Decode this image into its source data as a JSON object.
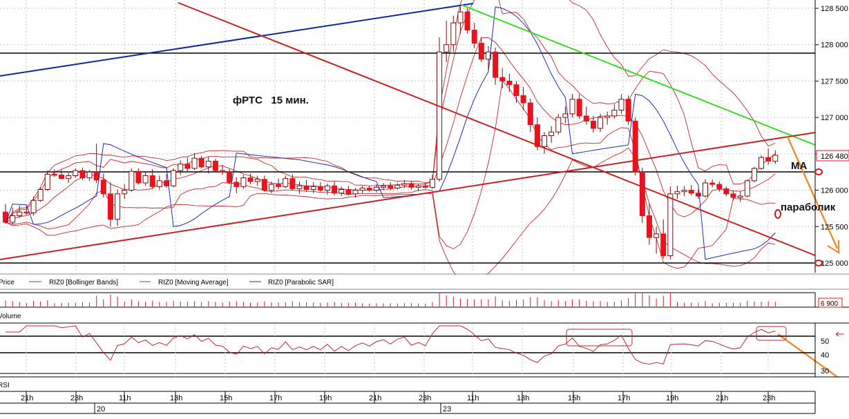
{
  "chart_data": {
    "type": "candlestick",
    "title": "фРТС   15 мин.",
    "price_axis": {
      "ticks": [
        125000,
        125500,
        126000,
        126500,
        127000,
        127500,
        128000,
        128500
      ],
      "min": 124900,
      "max": 128560,
      "last_price_label": "126 480"
    },
    "legend": [
      "Price",
      "RIZ0 [Bollinger Bands]",
      "RIZ0 [Moving Average]",
      "RIZ0 [Parabolic SAR]"
    ],
    "annotations": {
      "ma": "MA",
      "parabolic": "параболик"
    },
    "candles_ohlc": [
      [
        125700,
        125810,
        125540,
        125560
      ],
      [
        125560,
        125760,
        125530,
        125650
      ],
      [
        125650,
        125790,
        125620,
        125700
      ],
      [
        125700,
        125780,
        125660,
        125690
      ],
      [
        125690,
        125910,
        125650,
        125860
      ],
      [
        125860,
        126040,
        125840,
        126010
      ],
      [
        126010,
        126270,
        125990,
        126220
      ],
      [
        126220,
        126290,
        126180,
        126210
      ],
      [
        126210,
        126280,
        126150,
        126160
      ],
      [
        126160,
        126240,
        126100,
        126200
      ],
      [
        126200,
        126300,
        126170,
        126270
      ],
      [
        126270,
        126310,
        126140,
        126170
      ],
      [
        126170,
        126280,
        126130,
        126250
      ],
      [
        126250,
        126640,
        126100,
        126140
      ],
      [
        126140,
        126230,
        125900,
        125950
      ],
      [
        125950,
        126110,
        125500,
        125600
      ],
      [
        125600,
        126010,
        125510,
        125950
      ],
      [
        125950,
        126080,
        125880,
        126000
      ],
      [
        126000,
        126300,
        125980,
        126260
      ],
      [
        126260,
        126300,
        126080,
        126100
      ],
      [
        126100,
        126250,
        126060,
        126200
      ],
      [
        126200,
        126290,
        126020,
        126050
      ],
      [
        126050,
        126200,
        126010,
        126130
      ],
      [
        126130,
        126220,
        126030,
        126060
      ],
      [
        126060,
        126300,
        126040,
        126270
      ],
      [
        126270,
        126410,
        126210,
        126360
      ],
      [
        126360,
        126450,
        126250,
        126300
      ],
      [
        126300,
        126510,
        126280,
        126440
      ],
      [
        126440,
        126470,
        126300,
        126320
      ],
      [
        126320,
        126460,
        126230,
        126400
      ],
      [
        126400,
        126430,
        126240,
        126270
      ],
      [
        126270,
        126350,
        126210,
        126250
      ],
      [
        126250,
        126290,
        126080,
        126110
      ],
      [
        126110,
        126180,
        125960,
        126050
      ],
      [
        126050,
        126210,
        126020,
        126170
      ],
      [
        126170,
        126230,
        126080,
        126120
      ],
      [
        126120,
        126200,
        126060,
        126150
      ],
      [
        126150,
        126200,
        125980,
        126000
      ],
      [
        126000,
        126120,
        125960,
        126080
      ],
      [
        126080,
        126160,
        126010,
        126050
      ],
      [
        126050,
        126200,
        126030,
        126160
      ],
      [
        126160,
        126220,
        126000,
        126020
      ],
      [
        126020,
        126120,
        125950,
        126060
      ],
      [
        126060,
        126140,
        125980,
        126010
      ],
      [
        126010,
        126110,
        125960,
        126050
      ],
      [
        126050,
        126110,
        125980,
        126000
      ],
      [
        126000,
        126090,
        125940,
        126060
      ],
      [
        126060,
        126120,
        125930,
        125960
      ],
      [
        125960,
        126050,
        125920,
        126010
      ],
      [
        126010,
        126060,
        125930,
        125950
      ],
      [
        125950,
        126030,
        125900,
        126000
      ],
      [
        126000,
        126060,
        125960,
        126030
      ],
      [
        126030,
        126060,
        125980,
        126000
      ],
      [
        126000,
        126080,
        125970,
        126040
      ],
      [
        126040,
        126100,
        126000,
        126060
      ],
      [
        126060,
        126110,
        126000,
        126030
      ],
      [
        126030,
        126100,
        126010,
        126070
      ],
      [
        126070,
        126140,
        126030,
        126090
      ],
      [
        126090,
        126120,
        126010,
        126040
      ],
      [
        126040,
        126090,
        125990,
        126060
      ],
      [
        126060,
        126110,
        126020,
        126040
      ],
      [
        126040,
        126210,
        126020,
        126150
      ],
      [
        126150,
        128100,
        126120,
        127900
      ],
      [
        127900,
        128330,
        127760,
        128000
      ],
      [
        128000,
        128400,
        127900,
        128300
      ],
      [
        128300,
        128520,
        128150,
        128450
      ],
      [
        128450,
        128500,
        128150,
        128200
      ],
      [
        128200,
        128300,
        127950,
        128020
      ],
      [
        128020,
        128100,
        127760,
        127800
      ],
      [
        127800,
        127980,
        127640,
        127900
      ],
      [
        127900,
        127960,
        127450,
        127550
      ],
      [
        127550,
        127680,
        127400,
        127500
      ],
      [
        127500,
        127600,
        127350,
        127450
      ],
      [
        127450,
        127500,
        127200,
        127300
      ],
      [
        127300,
        127420,
        127100,
        127200
      ],
      [
        127200,
        127260,
        126800,
        126900
      ],
      [
        126900,
        127000,
        126550,
        126600
      ],
      [
        126600,
        126800,
        126500,
        126750
      ],
      [
        126750,
        126880,
        126650,
        126800
      ],
      [
        126800,
        127050,
        126760,
        127000
      ],
      [
        127000,
        127150,
        126920,
        127050
      ],
      [
        127050,
        127320,
        127000,
        127250
      ],
      [
        127250,
        127320,
        126980,
        127020
      ],
      [
        127020,
        127150,
        126900,
        126950
      ],
      [
        126950,
        127020,
        126790,
        126850
      ],
      [
        126850,
        127050,
        126800,
        127000
      ],
      [
        127000,
        127080,
        126900,
        127020
      ],
      [
        127020,
        127180,
        126980,
        127100
      ],
      [
        127100,
        127320,
        127050,
        127250
      ],
      [
        127250,
        127300,
        126900,
        126950
      ],
      [
        126950,
        127000,
        126200,
        126250
      ],
      [
        126250,
        126310,
        125550,
        125650
      ],
      [
        125650,
        125820,
        125250,
        125350
      ],
      [
        125350,
        125500,
        125130,
        125400
      ],
      [
        125400,
        125600,
        125060,
        125100
      ],
      [
        125100,
        126050,
        125050,
        125950
      ],
      [
        125950,
        126060,
        125880,
        125980
      ],
      [
        125980,
        126060,
        125920,
        126000
      ],
      [
        126000,
        126070,
        125930,
        125960
      ],
      [
        125960,
        126010,
        125880,
        125920
      ],
      [
        125920,
        126150,
        125900,
        126100
      ],
      [
        126100,
        126150,
        126040,
        126080
      ],
      [
        126080,
        126120,
        125980,
        126020
      ],
      [
        126020,
        126050,
        125920,
        125950
      ],
      [
        125950,
        125990,
        125860,
        125900
      ],
      [
        125900,
        125980,
        125840,
        125920
      ],
      [
        125920,
        126150,
        125900,
        126130
      ],
      [
        126130,
        126320,
        126110,
        126300
      ],
      [
        126300,
        126480,
        126280,
        126450
      ],
      [
        126450,
        126570,
        126350,
        126400
      ],
      [
        126400,
        126550,
        126360,
        126480
      ]
    ],
    "volume_panel": {
      "label": "Volume",
      "last_value_label": "6 900"
    },
    "rsi_panel": {
      "label": "RSI",
      "ticks": [
        50,
        40,
        30
      ]
    },
    "time_axis": {
      "hours": [
        "21h",
        "23h",
        "11h",
        "13h",
        "15h",
        "17h",
        "19h",
        "21h",
        "23h",
        "11h",
        "13h",
        "15h",
        "17h",
        "19h",
        "21h",
        "23h"
      ],
      "dates": [
        "20",
        "23"
      ]
    }
  },
  "colors": {
    "up": "#ffffff",
    "down": "#e8131c",
    "bollinger": "#c0282c",
    "ma": "#c0282c",
    "sar": "#1a2eb0",
    "blue_trend": "#0a28a0",
    "green_trend": "#33dd22",
    "red_trend": "#c8201e",
    "arrow": "#f08a2a",
    "grid": "#c6c6c6"
  }
}
